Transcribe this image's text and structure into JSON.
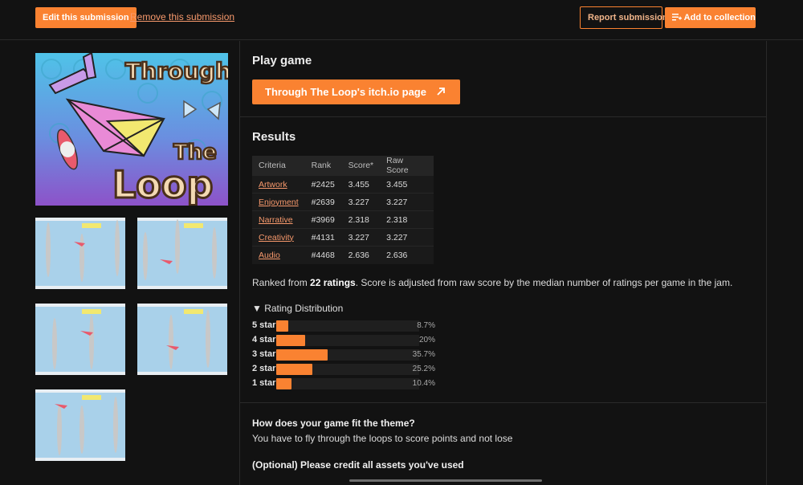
{
  "topbar": {
    "edit_label": "Edit this submission",
    "remove_label": "Remove this submission",
    "report_label": "Report submission",
    "collection_label": "Add to collection"
  },
  "play": {
    "heading": "Play game",
    "button_label": "Through The Loop's itch.io page"
  },
  "cover": {
    "title_line1": "Through",
    "title_line2": "The",
    "title_line3": "Loop"
  },
  "results": {
    "heading": "Results",
    "columns": [
      "Criteria",
      "Rank",
      "Score*",
      "Raw Score"
    ],
    "rows": [
      {
        "criteria": "Artwork",
        "rank": "#2425",
        "score": "3.455",
        "raw": "3.455"
      },
      {
        "criteria": "Enjoyment",
        "rank": "#2639",
        "score": "3.227",
        "raw": "3.227"
      },
      {
        "criteria": "Narrative",
        "rank": "#3969",
        "score": "2.318",
        "raw": "2.318"
      },
      {
        "criteria": "Creativity",
        "rank": "#4131",
        "score": "3.227",
        "raw": "3.227"
      },
      {
        "criteria": "Audio",
        "rank": "#4468",
        "score": "2.636",
        "raw": "2.636"
      }
    ],
    "ranked_prefix": "Ranked from ",
    "ranked_count": "22 ratings",
    "ranked_suffix": ". Score is adjusted from raw score by the median number of ratings per game in the jam."
  },
  "distribution": {
    "toggle_label": "▼ Rating Distribution",
    "rows": [
      {
        "label": "5 star",
        "pct_text": "8.7%",
        "fraction": 0.087
      },
      {
        "label": "4 star",
        "pct_text": "20%",
        "fraction": 0.2
      },
      {
        "label": "3 star",
        "pct_text": "35.7%",
        "fraction": 0.357
      },
      {
        "label": "2 star",
        "pct_text": "25.2%",
        "fraction": 0.252
      },
      {
        "label": "1 star",
        "pct_text": "10.4%",
        "fraction": 0.104
      }
    ]
  },
  "qa": {
    "q1": "How does your game fit the theme?",
    "a1": "You have to fly through the loops to score points and not lose",
    "q2": "(Optional) Please credit all assets you've used"
  },
  "colors": {
    "accent": "#fa8231",
    "background": "#121212"
  }
}
